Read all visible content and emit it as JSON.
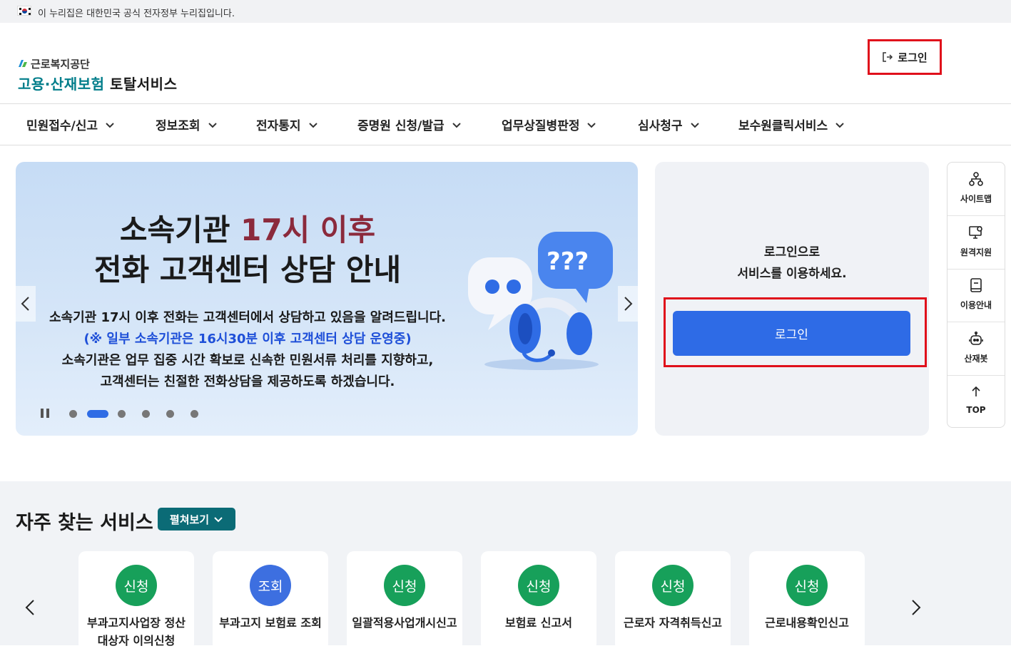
{
  "gov_banner": {
    "text": "이 누리집은 대한민국 공식 전자정부 누리집입니다."
  },
  "header": {
    "org_name": "근로복지공단",
    "title_part1": "고용·산재보험",
    "title_part2": "토탈서비스",
    "login_label": "로그인"
  },
  "gnb": {
    "items": [
      {
        "label": "민원접수/신고"
      },
      {
        "label": "정보조회"
      },
      {
        "label": "전자통지"
      },
      {
        "label": "증명원 신청/발급"
      },
      {
        "label": "업무상질병판정"
      },
      {
        "label": "심사청구"
      },
      {
        "label": "보수원클릭서비스"
      }
    ]
  },
  "banner": {
    "headline1_a": "소속기관",
    "headline1_b": "17시 이후",
    "headline2": "전화 고객센터 상담 안내",
    "line1": "소속기관 17시 이후 전화는 고객센터에서 상담하고 있음을 알려드립니다.",
    "line2": "(※ 일부 소속기관은 16시30분 이후 고객센터 상담 운영중)",
    "line3": "소속기관은 업무 집중 시간 확보로 신속한 민원서류 처리를 지향하고,",
    "line4": "고객센터는 친절한 전화상담을 제공하도록 하겠습니다.",
    "slide_count": 6,
    "active_slide": 2
  },
  "login_panel": {
    "message_line1": "로그인으로",
    "message_line2": "서비스를 이용하세요.",
    "button_label": "로그인"
  },
  "quick_menu": {
    "items": [
      {
        "label": "사이트맵",
        "icon": "sitemap-icon"
      },
      {
        "label": "원격지원",
        "icon": "remote-support-icon"
      },
      {
        "label": "이용안내",
        "icon": "guide-icon"
      },
      {
        "label": "산재봇",
        "icon": "chatbot-icon"
      },
      {
        "label": "TOP",
        "icon": "arrow-up-icon"
      }
    ]
  },
  "services": {
    "title": "자주 찾는 서비스",
    "expand_label": "펼쳐보기",
    "cards": [
      {
        "badge": "신청",
        "label": "부과고지사업장 정산대상자 이의신청"
      },
      {
        "badge": "조회",
        "label": "부과고지 보험료 조회"
      },
      {
        "badge": "신청",
        "label": "일괄적용사업개시신고"
      },
      {
        "badge": "신청",
        "label": "보험료 신고서"
      },
      {
        "badge": "신청",
        "label": "근로자 자격취득신고"
      },
      {
        "badge": "신청",
        "label": "근로내용확인신고"
      }
    ]
  },
  "colors": {
    "brand_teal": "#007d8a",
    "primary_blue": "#2e6be6",
    "highlight_red": "#e0101b",
    "badge_green": "#17a05a",
    "badge_blue": "#3d6fe0"
  }
}
